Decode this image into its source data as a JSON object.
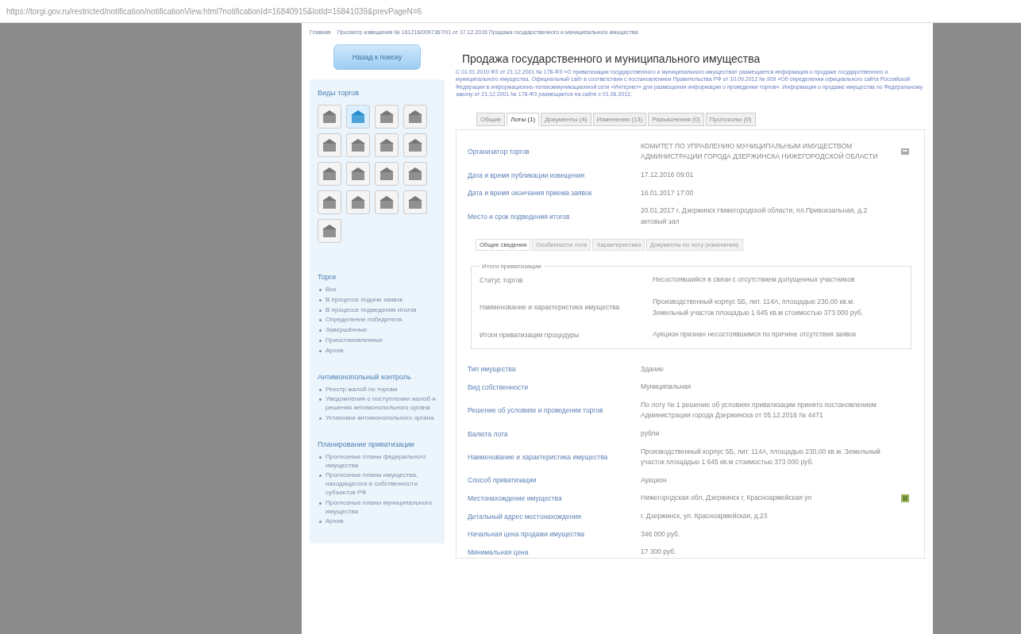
{
  "browser": {
    "url": "https://torgi.gov.ru/restricted/notification/notificationView.html?notificationId=16840915&lotId=16841039&prevPageN=6"
  },
  "breadcrumb": [
    "Главная",
    "Просмотр извещения № 161216/0097367/01 от 17.12.2016 Продажа государственного и муниципального имущества"
  ],
  "sidebar": {
    "back_button": "Назад к поиску",
    "trade_types_title": "Виды торгов",
    "trade_types": [
      {
        "selected": false
      },
      {
        "selected": true
      },
      {
        "selected": false
      },
      {
        "selected": false
      },
      {
        "selected": false
      },
      {
        "selected": false
      },
      {
        "selected": false
      },
      {
        "selected": false
      },
      {
        "selected": false
      },
      {
        "selected": false
      },
      {
        "selected": false
      },
      {
        "selected": false
      },
      {
        "selected": false
      },
      {
        "selected": false
      },
      {
        "selected": false
      },
      {
        "selected": false
      },
      {
        "selected": false
      }
    ],
    "sections": [
      {
        "title": "Торги",
        "items": [
          "Все",
          "В процессе подачи заявок",
          "В процессе подведения итогов",
          "Определение победителя",
          "Завершённые",
          "Приостановленные",
          "Архив"
        ]
      },
      {
        "title": "Антимонопольный контроль",
        "items": [
          "Реестр жалоб по торгам",
          "Уведомления о поступлении жалоб и решения антимонопольного органа",
          "Установки антимонопольного органа"
        ]
      },
      {
        "title": "Планирование приватизации",
        "items": [
          "Прогнозные планы федерального имущества",
          "Прогнозные планы имущества, находящегося в собственности субъектов РФ",
          "Прогнозные планы муниципального имущества",
          "Архив"
        ]
      }
    ]
  },
  "main": {
    "title": "Продажа государственного и муниципального имущества",
    "description": "С 01.01.2010 ФЗ от 21.12.2001 № 178-ФЗ «О приватизации государственного и муниципального имущества» размещается информация о продаже государственного и муниципального имущества. Официальный сайт в соответствии с постановлением Правительства РФ от 10.09.2012 № 909 «Об определении официального сайта Российской Федерации в информационно-телекоммуникационной сети «Интернет» для размещения информации о проведении торгов». Информация о продаже имущества по Федеральному закону от 21.12.2001 № 178-ФЗ размещается на сайте с 01.06.2012.",
    "tabs": [
      {
        "label": "Общие",
        "selected": false
      },
      {
        "label": "Лоты (1)",
        "selected": true
      },
      {
        "label": "Документы (4)",
        "selected": false
      },
      {
        "label": "Изменения (13)",
        "selected": false
      },
      {
        "label": "Разъяснения (0)",
        "selected": false
      },
      {
        "label": "Протоколы (0)",
        "selected": false
      }
    ],
    "fields": [
      {
        "label": "Организатор торгов",
        "value": "КОМИТЕТ ПО УПРАВЛЕНИЮ МУНИЦИПАЛЬНЫМ ИМУЩЕСТВОМ АДМИНИСТРАЦИИ ГОРОДА ДЗЕРЖИНСКА НИЖЕГОРОДСКОЙ ОБЛАСТИ",
        "kind": "card"
      },
      {
        "label": "Дата и время публикации извещения",
        "value": "17.12.2016 09:01",
        "kind": "plain"
      },
      {
        "label": "Дата и время окончания приема заявок",
        "value": "16.01.2017 17:00",
        "kind": "plain"
      },
      {
        "label": "Место и срок подведения итогов",
        "value": "20.01.2017 г. Дзержинск Нижегородской области, пл.Привокзальная, д.2 актовый зал",
        "kind": "plain"
      }
    ],
    "lot_tabs": [
      {
        "label": "Общие сведения",
        "selected": true
      },
      {
        "label": "Особенности лота",
        "selected": false
      },
      {
        "label": "Характеристики",
        "selected": false
      },
      {
        "label": "Документы по лоту (изменения)",
        "selected": false
      }
    ],
    "results": {
      "title": "Итоги приватизации",
      "fields": [
        {
          "label": "Статус торгов",
          "value": "Несостоявшийся в связи с отсутствием допущенных участников"
        },
        {
          "label": "Наименование и характеристика имущества",
          "value": "Производственный корпус 5Б, лит. 114А, площадью 230,00 кв.м. Земельный участок площадью 1 645 кв.м стоимостью 373 000 руб."
        },
        {
          "label": "Итоги приватизации процедуры",
          "value": "Аукцион признан несостоявшимся по причине отсутствия заявок"
        }
      ]
    },
    "lot_fields": [
      {
        "label": "Тип имущества",
        "value": "Здание",
        "kind": "plain"
      },
      {
        "label": "Вид собственности",
        "value": "Муниципальная",
        "kind": "plain"
      },
      {
        "label": "Решение об условиях и проведении торгов",
        "value": "По лоту № 1 решение об условиях приватизации принято постановлением Администрации города Дзержинска от 05.12.2016 № 4471",
        "kind": "plain"
      },
      {
        "label": "Валюта лота",
        "value": "рубли",
        "kind": "plain"
      },
      {
        "label": "Наименование и характеристика имущества",
        "value": "Производственный корпус 5Б, лит. 114А, площадью 230,00 кв.м. Земельный участок площадью 1 645 кв.м стоимостью 373 000 руб.",
        "kind": "plain"
      },
      {
        "label": "Способ приватизации",
        "value": "Аукцион",
        "kind": "plain"
      },
      {
        "label": "Местонахождение имущества",
        "value": "Нижегородская обл, Дзержинск г, Красноармейская ул",
        "kind": "map"
      },
      {
        "label": "Детальный адрес местонахождения",
        "value": "г. Дзержинск, ул. Красноармейская, д.23",
        "kind": "plain"
      },
      {
        "label": "Начальная цена продажи имущества",
        "value": "346 000 руб.",
        "kind": "plain"
      },
      {
        "label": "Минимальная цена",
        "value": "17 300 руб.",
        "kind": "plain"
      }
    ]
  }
}
